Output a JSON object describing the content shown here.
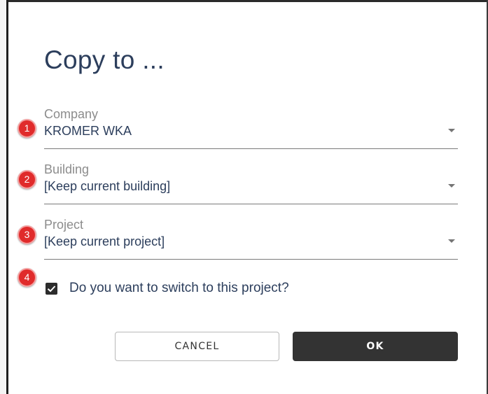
{
  "dialog": {
    "title": "Copy to ...",
    "fields": [
      {
        "marker": "1",
        "label": "Company",
        "value": "KROMER WKA"
      },
      {
        "marker": "2",
        "label": "Building",
        "value": "[Keep current building]"
      },
      {
        "marker": "3",
        "label": "Project",
        "value": "[Keep current project]"
      }
    ],
    "checkbox": {
      "marker": "4",
      "label": "Do you want to switch to this project?",
      "checked": true
    },
    "buttons": {
      "cancel": "CANCEL",
      "ok": "OK"
    }
  },
  "colors": {
    "title_text": "#2c3e5c",
    "marker_red": "#e02b2b",
    "ok_button": "#333333"
  }
}
